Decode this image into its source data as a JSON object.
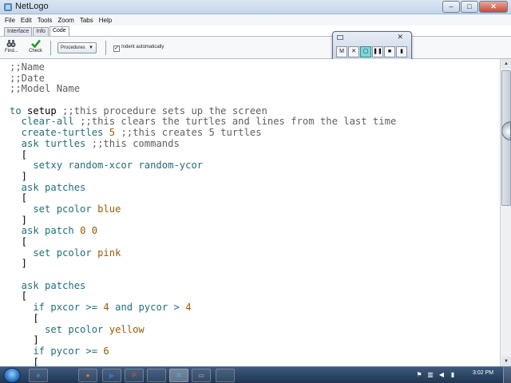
{
  "window": {
    "title": "NetLogo",
    "buttons": {
      "minimize": "‒",
      "maximize": "□",
      "close": "✕"
    }
  },
  "menu": [
    "File",
    "Edit",
    "Tools",
    "Zoom",
    "Tabs",
    "Help"
  ],
  "tabs": [
    {
      "label": "Interface",
      "active": false
    },
    {
      "label": "Info",
      "active": false
    },
    {
      "label": "Code",
      "active": true
    }
  ],
  "toolbar": {
    "find_label": "Find...",
    "check_label": "Check",
    "procedures_label": "Procedures",
    "indent_checked": "✓",
    "indent_label": "Indent automatically"
  },
  "recorder": {
    "close": "✕",
    "buttons": [
      {
        "icon": "mark-icon",
        "glyph": "M"
      },
      {
        "icon": "cross-icon",
        "glyph": "✕"
      },
      {
        "icon": "record-region-icon",
        "glyph": "▢"
      },
      {
        "icon": "pause-icon",
        "glyph": "❚❚"
      },
      {
        "icon": "stop-icon",
        "glyph": "■"
      },
      {
        "icon": "marker-icon",
        "glyph": "▮"
      }
    ]
  },
  "code": [
    [
      {
        "t": ";;Name",
        "c": "cmt"
      }
    ],
    [
      {
        "t": ";;Date",
        "c": "cmt"
      }
    ],
    [
      {
        "t": ";;Model Name",
        "c": "cmt"
      }
    ],
    [],
    [
      {
        "t": "to ",
        "c": "kw"
      },
      {
        "t": "setup ",
        "c": "txt"
      },
      {
        "t": ";;this procedure sets up the screen",
        "c": "cmt"
      }
    ],
    [
      {
        "t": "  clear-all ",
        "c": "kw"
      },
      {
        "t": ";;this clears the turtles and lines from the last time",
        "c": "cmt"
      }
    ],
    [
      {
        "t": "  create-turtles ",
        "c": "kw"
      },
      {
        "t": "5 ",
        "c": "num"
      },
      {
        "t": ";;this creates 5 turtles",
        "c": "cmt"
      }
    ],
    [
      {
        "t": "  ask ",
        "c": "kw"
      },
      {
        "t": "turtles ",
        "c": "kw"
      },
      {
        "t": ";;this commands",
        "c": "cmt"
      }
    ],
    [
      {
        "t": "  [",
        "c": "txt"
      }
    ],
    [
      {
        "t": "    setxy random-xcor random-ycor",
        "c": "kw"
      }
    ],
    [
      {
        "t": "  ]",
        "c": "txt"
      }
    ],
    [
      {
        "t": "  ask ",
        "c": "kw"
      },
      {
        "t": "patches",
        "c": "kw"
      }
    ],
    [
      {
        "t": "  [",
        "c": "txt"
      }
    ],
    [
      {
        "t": "    set ",
        "c": "kw"
      },
      {
        "t": "pcolor ",
        "c": "kw"
      },
      {
        "t": "blue",
        "c": "num"
      }
    ],
    [
      {
        "t": "  ]",
        "c": "txt"
      }
    ],
    [
      {
        "t": "  ask ",
        "c": "kw"
      },
      {
        "t": "patch ",
        "c": "kw"
      },
      {
        "t": "0 0",
        "c": "num"
      }
    ],
    [
      {
        "t": "  [",
        "c": "txt"
      }
    ],
    [
      {
        "t": "    set ",
        "c": "kw"
      },
      {
        "t": "pcolor ",
        "c": "kw"
      },
      {
        "t": "pink",
        "c": "num"
      }
    ],
    [
      {
        "t": "  ]",
        "c": "txt"
      }
    ],
    [],
    [
      {
        "t": "  ask ",
        "c": "kw"
      },
      {
        "t": "patches",
        "c": "kw"
      }
    ],
    [
      {
        "t": "  [",
        "c": "txt"
      }
    ],
    [
      {
        "t": "    if ",
        "c": "kw"
      },
      {
        "t": "pxcor ",
        "c": "kw"
      },
      {
        "t": ">= ",
        "c": "kw"
      },
      {
        "t": "4 ",
        "c": "num"
      },
      {
        "t": "and ",
        "c": "kw"
      },
      {
        "t": "pycor ",
        "c": "kw"
      },
      {
        "t": "> ",
        "c": "kw"
      },
      {
        "t": "4",
        "c": "num"
      }
    ],
    [
      {
        "t": "    [",
        "c": "txt"
      }
    ],
    [
      {
        "t": "      set ",
        "c": "kw"
      },
      {
        "t": "pcolor ",
        "c": "kw"
      },
      {
        "t": "yellow",
        "c": "num"
      }
    ],
    [
      {
        "t": "    ]",
        "c": "txt"
      }
    ],
    [
      {
        "t": "    if ",
        "c": "kw"
      },
      {
        "t": "pycor ",
        "c": "kw"
      },
      {
        "t": ">= ",
        "c": "kw"
      },
      {
        "t": "6",
        "c": "num"
      }
    ],
    [
      {
        "t": "    [",
        "c": "txt"
      }
    ]
  ],
  "taskbar": {
    "apps": [
      {
        "name": "internet-explorer",
        "glyph": "e",
        "color": "#3b8fd9",
        "active": false
      },
      {
        "name": "firefox",
        "glyph": "●",
        "color": "#e8761f",
        "active": false
      },
      {
        "name": "media-player",
        "glyph": "▶",
        "color": "#3a6fc4",
        "active": false
      },
      {
        "name": "powerpoint",
        "glyph": "P",
        "color": "#d24726",
        "active": false
      },
      {
        "name": "word",
        "glyph": "W",
        "color": "#2b579a",
        "active": false
      },
      {
        "name": "netlogo",
        "glyph": "N",
        "color": "#5aa0d8",
        "active": true
      },
      {
        "name": "recorder",
        "glyph": "▭",
        "color": "#8a8f96",
        "active": false
      },
      {
        "name": "excel",
        "glyph": "X",
        "color": "#217346",
        "active": false
      }
    ],
    "clock": "3:02 PM"
  },
  "colors": {
    "keyword": "#1f6f7a",
    "comment": "#5f5f5f",
    "constant": "#9c5b00"
  }
}
